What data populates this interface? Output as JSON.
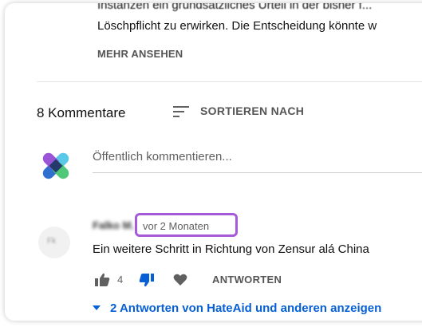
{
  "video": {
    "description_partial_top": "Instanzen ein grundsätzliches Urteil in der bisher f...",
    "description_line": "Löschpflicht zu erwirken. Die Entscheidung könnte w",
    "more_label": "MEHR ANSEHEN"
  },
  "comments_header": {
    "count_label": "8 Kommentare",
    "sort_label": "SORTIEREN NACH",
    "sort_icon": "sort-icon"
  },
  "comment_input": {
    "placeholder": "Öffentlich kommentieren...",
    "avatar_icon": "hateaid-logo"
  },
  "comment": {
    "author": "Falko M.",
    "avatar_text": "Fk",
    "time": "vor 2 Monaten",
    "text": "Ein weitere Schritt in Richtung von Zensur alá China",
    "like_count": "4",
    "reply_label": "ANTWORTEN",
    "icons": [
      "thumb-up-icon",
      "thumb-down-icon",
      "heart-icon"
    ]
  },
  "replies": {
    "toggle_label": "2 Antworten von HateAid und anderen anzeigen",
    "icon": "caret-down-icon"
  },
  "colors": {
    "highlight": "#a55ad8",
    "link": "#065fd4",
    "dislike_active": "#065fd4"
  }
}
